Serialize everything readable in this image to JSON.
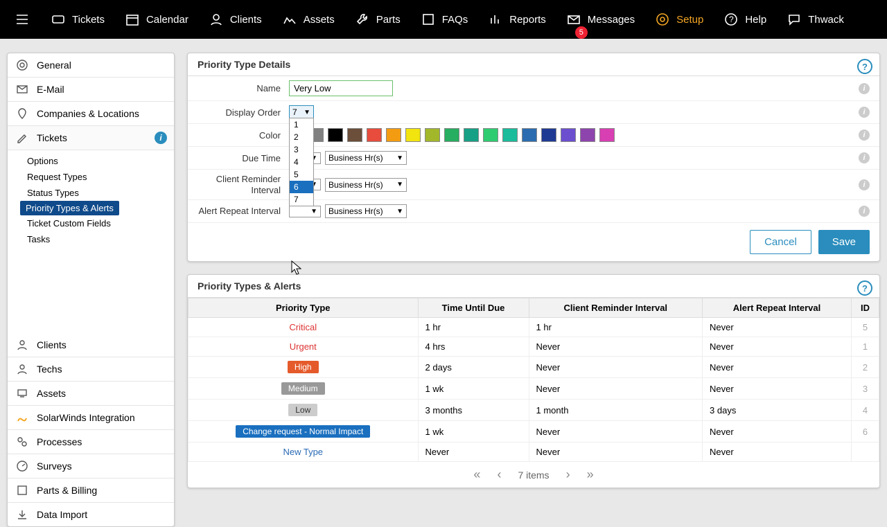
{
  "topnav": {
    "items": [
      {
        "label": "Tickets"
      },
      {
        "label": "Calendar"
      },
      {
        "label": "Clients"
      },
      {
        "label": "Assets"
      },
      {
        "label": "Parts"
      },
      {
        "label": "FAQs"
      },
      {
        "label": "Reports"
      },
      {
        "label": "Messages",
        "badge": "5"
      },
      {
        "label": "Setup"
      },
      {
        "label": "Help"
      },
      {
        "label": "Thwack"
      }
    ]
  },
  "sidebar": {
    "top": [
      {
        "label": "General"
      },
      {
        "label": "E-Mail"
      },
      {
        "label": "Companies & Locations"
      },
      {
        "label": "Tickets"
      }
    ],
    "tickets_sub": [
      {
        "label": "Options"
      },
      {
        "label": "Request Types"
      },
      {
        "label": "Status Types"
      },
      {
        "label": "Priority Types & Alerts"
      },
      {
        "label": "Ticket Custom Fields"
      },
      {
        "label": "Tasks"
      }
    ],
    "bottom": [
      {
        "label": "Clients"
      },
      {
        "label": "Techs"
      },
      {
        "label": "Assets"
      },
      {
        "label": "SolarWinds Integration"
      },
      {
        "label": "Processes"
      },
      {
        "label": "Surveys"
      },
      {
        "label": "Parts & Billing"
      },
      {
        "label": "Data Import"
      }
    ]
  },
  "details": {
    "title": "Priority Type Details",
    "labels": {
      "name": "Name",
      "display_order": "Display Order",
      "color": "Color",
      "due_time": "Due Time",
      "client_reminder": "Client Reminder Interval",
      "alert_repeat": "Alert Repeat Interval"
    },
    "name_value": "Very Low",
    "display_order_value": "7",
    "dropdown_options": [
      "1",
      "2",
      "3",
      "4",
      "5",
      "6",
      "7"
    ],
    "dropdown_hover_index": 5,
    "due_unit": "Business Hr(s)",
    "client_unit": "Business Hr(s)",
    "alert_unit": "Business Hr(s)",
    "colors": [
      "#e5e5e5",
      "#808080",
      "#000000",
      "#6b4f3a",
      "#e74c3c",
      "#f39c12",
      "#f1e40f",
      "#a3b72b",
      "#27ae60",
      "#16a085",
      "#2ecc71",
      "#1abc9c",
      "#2b6cb0",
      "#1f3a93",
      "#6b4fcf",
      "#8e44ad",
      "#d83fb3"
    ],
    "buttons": {
      "cancel": "Cancel",
      "save": "Save"
    }
  },
  "list": {
    "title": "Priority Types & Alerts",
    "headers": [
      "Priority Type",
      "Time Until Due",
      "Client Reminder Interval",
      "Alert Repeat Interval",
      "ID"
    ],
    "rows": [
      {
        "type": "Critical",
        "style": "t-critical",
        "due": "1 hr",
        "cri": "1 hr",
        "ari": "Never",
        "id": "5"
      },
      {
        "type": "Urgent",
        "style": "t-urgent",
        "due": "4 hrs",
        "cri": "Never",
        "ari": "Never",
        "id": "1"
      },
      {
        "type": "High",
        "badge": "b-high",
        "due": "2 days",
        "cri": "Never",
        "ari": "Never",
        "id": "2"
      },
      {
        "type": "Medium",
        "badge": "b-medium",
        "due": "1 wk",
        "cri": "Never",
        "ari": "Never",
        "id": "3"
      },
      {
        "type": "Low",
        "badge": "b-low",
        "due": "3 months",
        "cri": "1 month",
        "ari": "3 days",
        "id": "4"
      },
      {
        "type": "Change request - Normal Impact",
        "badge": "b-change",
        "due": "1 wk",
        "cri": "Never",
        "ari": "Never",
        "id": "6"
      },
      {
        "type": "New Type",
        "style": "type-link",
        "due": "Never",
        "cri": "Never",
        "ari": "Never",
        "id": ""
      }
    ],
    "pager": "7 items"
  }
}
